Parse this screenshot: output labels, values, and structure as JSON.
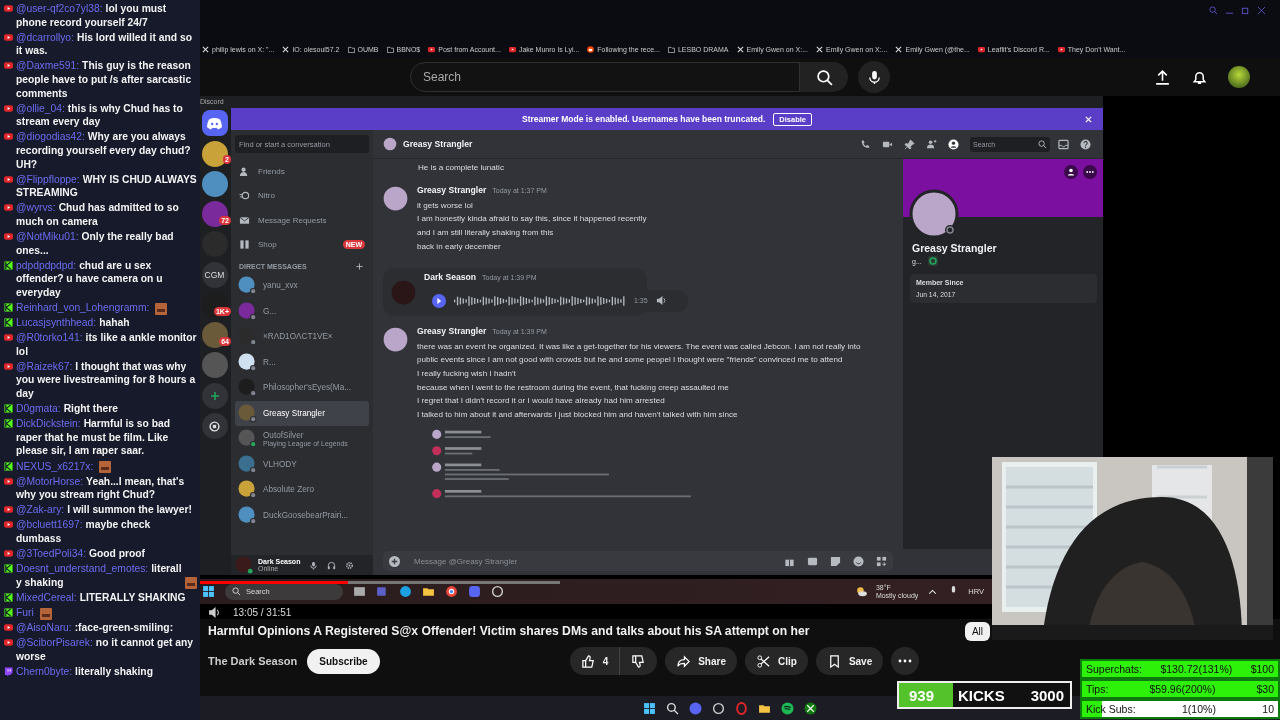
{
  "chat": [
    {
      "kind": "youtube",
      "user": "@user-qf2co7yl38:",
      "text": "lol you must phone record yourself 24/7",
      "emote": false
    },
    {
      "kind": "youtube",
      "user": "@dcarrollyo:",
      "text": "His lord willed it and so it was.",
      "emote": false
    },
    {
      "kind": "youtube",
      "user": "@Daxme591:",
      "text": "This guy is the reason people have to put /s after sarcastic comments",
      "emote": false
    },
    {
      "kind": "youtube",
      "user": "@ollie_04:",
      "text": "this is why Chud has to stream every day",
      "emote": false
    },
    {
      "kind": "youtube",
      "user": "@diogodias42:",
      "text": "Why are you always recording yourself every day chud? UH?",
      "emote": false
    },
    {
      "kind": "youtube",
      "user": "@Flippfloppe:",
      "text": "WHY IS CHUD ALWAYS STREAMING",
      "emote": false
    },
    {
      "kind": "youtube",
      "user": "@wyrvs:",
      "text": "Chud has admitted to so much on camera",
      "emote": false
    },
    {
      "kind": "youtube",
      "user": "@NotMiku01:",
      "text": "Only the really bad ones...",
      "emote": false
    },
    {
      "kind": "kick",
      "user": "pdpdpdpdpd:",
      "text": "chud are u sex offender? u have camera on u everyday",
      "emote": false
    },
    {
      "kind": "kick",
      "user": "Reinhard_von_Lohengramm:",
      "emote": true
    },
    {
      "kind": "kick",
      "user": "Lucasjsynthhead:",
      "text": "hahah",
      "emote": false
    },
    {
      "kind": "youtube",
      "user": "@R0torko141:",
      "text": "its like a ankle monitor lol",
      "emote": false
    },
    {
      "kind": "youtube",
      "user": "@Raizek67:",
      "text": "I thought that was why you were livestreaming for 8 hours a day",
      "emote": false
    },
    {
      "kind": "kick",
      "user": "D0gmata:",
      "text": "Right there",
      "emote": false
    },
    {
      "kind": "kick",
      "user": "DickDickstein:",
      "text": "Harmful is so bad raper that he must be film. Like please sir, I am raper saar.",
      "emote": false
    },
    {
      "kind": "kick",
      "user": "NEXUS_x6217x:",
      "emote": true
    },
    {
      "kind": "youtube",
      "user": "@MotorHorse:",
      "text": "Yeah...I mean, that's why you stream right Chud?",
      "emote": false
    },
    {
      "kind": "youtube",
      "user": "@Zak-ary:",
      "text": "I will summon the lawyer!",
      "emote": false
    },
    {
      "kind": "youtube",
      "user": "@bcluett1697:",
      "text": "maybe check dumbass",
      "emote": false
    },
    {
      "kind": "youtube",
      "user": "@3ToedPoli34:",
      "text": "Good proof",
      "emote": false
    },
    {
      "kind": "kick",
      "user": "Doesnt_understand_emotes:",
      "text": "literally shaking",
      "emote": true
    },
    {
      "kind": "kick",
      "user": "MixedCereal:",
      "text": "LITERALLY SHAKING",
      "emote": false
    },
    {
      "kind": "kick",
      "user": "Furi",
      "emote": true
    },
    {
      "kind": "youtube",
      "user": "@AisoNaru:",
      "text": ":face-green-smiling:",
      "emote": false
    },
    {
      "kind": "youtube",
      "user": "@SciborPisarek:",
      "text": "no it cannot get any worse",
      "emote": false
    },
    {
      "kind": "twitch",
      "user": "Chern0byte:",
      "text": "literally shaking",
      "emote": false
    }
  ],
  "bookmarks": [
    {
      "kind": "x",
      "label": "philip lewis on X: \"..."
    },
    {
      "kind": "x",
      "label": "IO: olesoul57.2"
    },
    {
      "kind": "folder",
      "label": "OUMB"
    },
    {
      "kind": "folder",
      "label": "BBNO$"
    },
    {
      "kind": "youtube",
      "label": "Post from Account..."
    },
    {
      "kind": "youtube",
      "label": "Jake Munro Is Lyi..."
    },
    {
      "kind": "reddit",
      "label": "Following the rece..."
    },
    {
      "kind": "folder",
      "label": "LESBO DRAMA"
    },
    {
      "kind": "x",
      "label": "Emily Gwen on X:..."
    },
    {
      "kind": "x",
      "label": "Emily Gwen on X:..."
    },
    {
      "kind": "x",
      "label": "Emily Gwen (@the..."
    },
    {
      "kind": "youtube",
      "label": "Leaflit's Discord R..."
    },
    {
      "kind": "youtube",
      "label": "They Don't Want..."
    }
  ],
  "youtube": {
    "search": {
      "placeholder": "Search"
    }
  },
  "discord": {
    "app_label": "Discord",
    "servers": [
      {
        "kind": "home"
      },
      {
        "kind": "avatar",
        "badge": "2"
      },
      {
        "kind": "avatar"
      },
      {
        "kind": "avatar",
        "badge": "72"
      },
      {
        "kind": "avatar"
      },
      {
        "kind": "text",
        "label": "CGM"
      },
      {
        "kind": "avatar",
        "badge": "1K+"
      },
      {
        "kind": "avatar",
        "badge": "64"
      },
      {
        "kind": "avatar"
      },
      {
        "kind": "add"
      },
      {
        "kind": "explore"
      }
    ],
    "banner": {
      "text": "Streamer Mode is enabled. Usernames have been truncated.",
      "button": "Disable"
    },
    "sidebar": {
      "search": {
        "placeholder": "Find or start a conversation"
      },
      "nav": [
        {
          "kind": "friends",
          "label": "Friends"
        },
        {
          "kind": "nitro",
          "label": "Nitro"
        },
        {
          "kind": "requests",
          "label": "Message Requests"
        },
        {
          "kind": "shop",
          "label": "Shop",
          "badge": "NEW"
        }
      ],
      "dm_heading": "DIRECT MESSAGES",
      "dms": [
        {
          "name": "yanu_xvx",
          "online": false,
          "selected": false
        },
        {
          "name": "G...",
          "online": false,
          "selected": false
        },
        {
          "name": "×RΛD1OΛCT1VE×",
          "online": false,
          "selected": false
        },
        {
          "name": "R...",
          "online": false,
          "selected": false
        },
        {
          "name": "Philosopher'sEyes(Ma...",
          "online": false,
          "selected": false
        },
        {
          "name": "Greasy Strangler",
          "online": false,
          "selected": true
        },
        {
          "name": "OutofSilver",
          "activity": "Playing League of Legends",
          "online": true,
          "selected": false
        },
        {
          "name": "VLHODY",
          "online": false,
          "selected": false
        },
        {
          "name": "Absolute Zero",
          "online": false,
          "selected": false
        },
        {
          "name": "DuckGoosebearPrairi...",
          "online": false,
          "selected": false
        }
      ],
      "user": {
        "name": "Dark Season",
        "status": "Online"
      }
    },
    "channel": {
      "title": "Greasy Strangler",
      "search": {
        "placeholder": "Search"
      }
    },
    "messages": [
      {
        "kind": "continuation",
        "lines": [
          "He is a complete lunatic"
        ]
      },
      {
        "kind": "text",
        "author": "Greasy Strangler",
        "time": "Today at 1:37 PM",
        "lines": [
          "it gets worse lol",
          "I am honestly kinda afraid to say this, since it happened recently",
          "and I am still literally shaking from this",
          "back in early december"
        ]
      },
      {
        "kind": "voice",
        "author": "Dark Season",
        "time": "Today at 1:39 PM",
        "duration": "1:35"
      },
      {
        "kind": "text",
        "author": "Greasy Strangler",
        "time": "Today at 1:39 PM",
        "lines": [
          "there was an event he organized. It was like a get-together for his viewers. The event was called Jebcon. I am not really into public events since I am not good with crowds but he and some peopel I thought were \"friends\" convinced me to attend",
          "I really fucking wish I hadn't",
          "because when I went to the restroom during the event, that fucking creep assaulted me",
          "I regret that I didn't record it or I would have already had him arrested",
          "I talked to him about it and afterwards I just blocked him and haven't talked with him since"
        ],
        "attachment": {
          "kind": "picture"
        }
      }
    ],
    "composer": {
      "placeholder": "Message @Greasy Strangler"
    },
    "profile": {
      "name": "Greasy Strangler",
      "tag": "g...",
      "member_label": "Member Since",
      "member_date": "Jun 14, 2017"
    }
  },
  "player": {
    "time": "13:05 / 31:51",
    "level": 0.41,
    "taskbar": {
      "search": "Search",
      "temperature": "38°F",
      "weather": "Mostly cloudy",
      "tray_label": "HRV"
    }
  },
  "video": {
    "title": "Harmful Opinions A Registered S@x Offender! Victim shares DMs and talks about his SA attempt on her",
    "channel": "The Dark Season",
    "subscribe": "Subscribe",
    "chip": "All",
    "actions": [
      {
        "kind": "like",
        "label": "4"
      },
      {
        "kind": "dislike"
      },
      {
        "kind": "share",
        "label": "Share"
      },
      {
        "kind": "clip",
        "label": "Clip"
      },
      {
        "kind": "save",
        "label": "Save"
      },
      {
        "kind": "more"
      }
    ]
  },
  "kicks": {
    "count": "939",
    "label": "KICKS",
    "goal": "3000",
    "level": 0.313
  },
  "goals": [
    {
      "label": "Superchats:",
      "amount": "$130.72(131%)",
      "goal": "$100",
      "level": 1
    },
    {
      "label": "Tips:",
      "amount": "$59.96(200%)",
      "goal": "$30",
      "level": 1
    },
    {
      "label": "Kick Subs:",
      "amount": "1(10%)",
      "goal": "10",
      "level": 0.1
    }
  ]
}
